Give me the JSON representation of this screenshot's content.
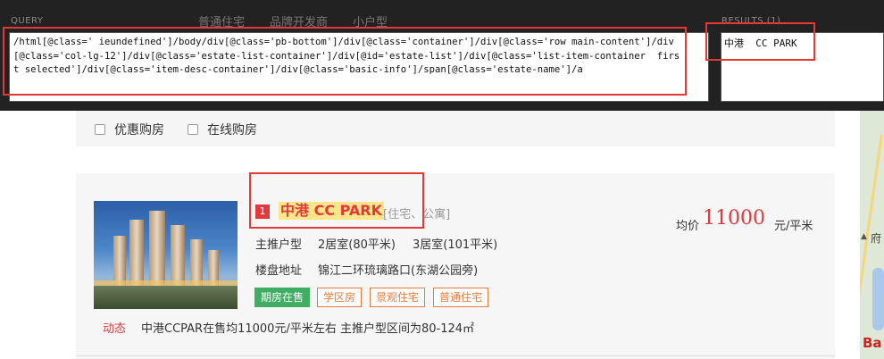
{
  "xpath_helper": {
    "query_label": "QUERY",
    "results_label": "RESULTS (1)",
    "query": "/html[@class=' ieundefined']/body/div[@class='pb-bottom']/div[@class='container']/div[@class='row main-content']/div[@class='col-lg-12']/div[@class='estate-list-container']/div[@id='estate-list']/div[@class='list-item-container  first selected']/div[@class='item-desc-container']/div[@class='basic-info']/span[@class='estate-name']/a",
    "result": "中港  CC PARK"
  },
  "page_tabs": [
    "普通住宅",
    "品牌开发商",
    "小户型"
  ],
  "filters": [
    {
      "label": "优惠购房",
      "checked": false
    },
    {
      "label": "在线购房",
      "checked": false
    }
  ],
  "listing": {
    "rank": "1",
    "name": "中港 CC PARK",
    "type": "[住宅、公寓]",
    "layout_label": "主推户型",
    "layout_1": "2居室(80平米)",
    "layout_2": "3居室(101平米)",
    "address_label": "楼盘地址",
    "address": "锦江二环琉璃路口(东湖公园旁)",
    "tags": [
      "期房在售",
      "学区房",
      "景观住宅",
      "普通住宅"
    ],
    "price_label": "均价",
    "price": "11000",
    "price_unit": "元/平米",
    "news_label": "动态",
    "news": "中港CCPAR在售均11000元/平米左右 主推户型区间为80-124㎡"
  },
  "map": {
    "label": "府"
  },
  "colors": {
    "accent_red": "#e4393c",
    "highlight_red": "#e53935",
    "tag_green": "#3fae62",
    "tag_orange": "#e97a3b"
  }
}
